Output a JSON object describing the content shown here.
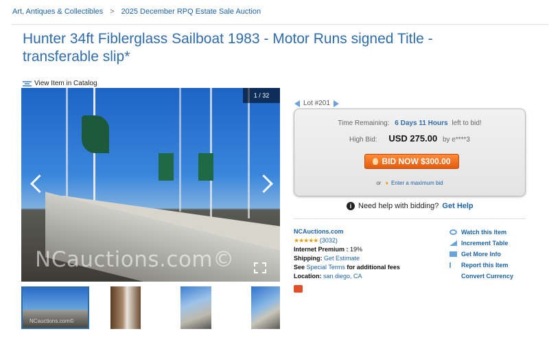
{
  "breadcrumb": {
    "category": "Art, Antiques & Collectibles",
    "separator": ">",
    "auction": "2025 December RPQ Estate Sale Auction"
  },
  "item": {
    "title": "Hunter 34ft Fiblerglass Sailboat 1983 - Motor Runs signed Title - transferable slip*",
    "catalog_link": "View Item in Catalog"
  },
  "gallery": {
    "counter": "1 / 32",
    "watermark": "NCauctions.com©",
    "thumb_watermark": "NCauctions.com©",
    "icons": [
      "prev-arrow-icon",
      "next-arrow-icon",
      "fullscreen-icon"
    ]
  },
  "lot": {
    "label": "Lot #201"
  },
  "bid": {
    "time_label": "Time Remaining:",
    "time_value": "6 Days 11 Hours",
    "time_suffix": "left to bid!",
    "high_bid_label": "High Bid:",
    "high_bid_value": "USD 275.00",
    "high_bidder": "by e****3",
    "button_label": "BID NOW $300.00",
    "max_prefix": "or",
    "max_link": "Enter a maximum bid"
  },
  "help": {
    "text": "Need help with bidding?",
    "link": "Get Help"
  },
  "seller": {
    "name": "NCAuctions.com",
    "stars": "★★★★★",
    "rating_count": "(3032)",
    "premium_label": "Internet Premium :",
    "premium_value": "19%",
    "shipping_label": "Shipping:",
    "shipping_link": "Get Estimate",
    "terms_prefix": "See",
    "terms_link": "Special Terms",
    "terms_suffix": "for additional fees",
    "location_label": "Location:",
    "location_value": "san diego, CA"
  },
  "actions": {
    "watch": "Watch this Item",
    "increment": "Increment Table",
    "info": "Get More Info",
    "report": "Report this Item",
    "currency": "Convert Currency"
  },
  "colors": {
    "accent": "#2f6cac",
    "bid_button": "#e45a0e",
    "stars": "#e0a000"
  }
}
